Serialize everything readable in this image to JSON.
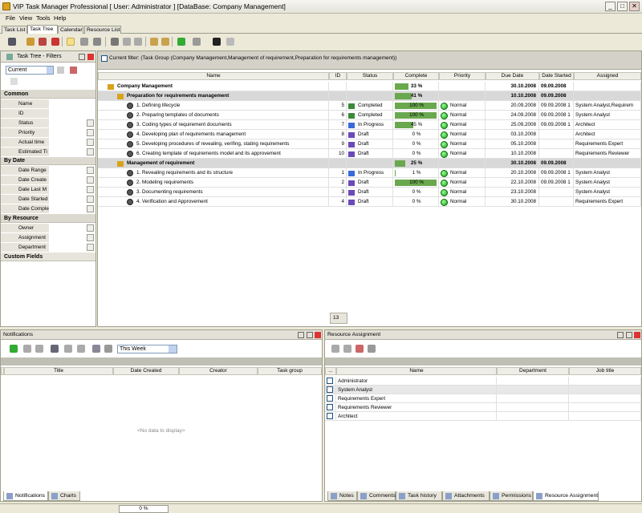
{
  "window": {
    "title": "VIP Task Manager Professional [ User: Administrator ] [DataBase: Company Management]",
    "min": "_",
    "max": "□",
    "close": "✕"
  },
  "menu": [
    "File",
    "View",
    "Tools",
    "Help"
  ],
  "tabs": [
    "Task List",
    "Task Tree",
    "Calendar",
    "Resource List"
  ],
  "left": {
    "title": "Task Tree - Filters",
    "combo": "Current",
    "sections": {
      "common": "Common",
      "bydate": "By Date",
      "byres": "By Resource",
      "custom": "Custom Fields"
    },
    "common": [
      "Name",
      "ID",
      "Status",
      "Priority",
      "Actual time",
      "Estimated Ti"
    ],
    "bydate": [
      "Date Range",
      "Date Create",
      "Date Last M",
      "Date Started",
      "Date Comple"
    ],
    "byres": [
      "Owner",
      "Assignment",
      "Department"
    ]
  },
  "main": {
    "filter": "Current filter:  (Task Group  (Company Management,Management of requirement,Preparation for requirements management))",
    "headers": [
      "Name",
      "ID",
      "Status",
      "Complete",
      "Priority",
      "Due Date",
      "Date Started",
      "Assigned"
    ],
    "footer_count": "13",
    "rows": [
      {
        "kind": "root",
        "name": "Company Management",
        "complete": "33 %",
        "pct": 0.33,
        "due": "30.10.2008",
        "started": "09.09.2008"
      },
      {
        "kind": "grp",
        "name": "Preparation for requirements management",
        "complete": "41 %",
        "pct": 0.41,
        "due": "10.10.2008",
        "started": "09.09.2008"
      },
      {
        "kind": "task",
        "name": "1. Defining lifecycle",
        "id": "5",
        "status": "Completed",
        "complete": "100 %",
        "pct": 1,
        "priority": "Normal",
        "due": "20.09.2008",
        "started": "09.09.2008 1",
        "assigned": "System Analyst,Requirem"
      },
      {
        "kind": "task",
        "name": "2. Preparing templates of documents",
        "id": "6",
        "status": "Completed",
        "complete": "100 %",
        "pct": 1,
        "priority": "Normal",
        "due": "24.09.2008",
        "started": "09.09.2008 1",
        "assigned": "System Analyst"
      },
      {
        "kind": "task",
        "name": "3. Coding types of requirement documents",
        "id": "7",
        "status": "In Progress",
        "complete": "45 %",
        "pct": 0.45,
        "priority": "Normal",
        "due": "25.09.2008",
        "started": "09.09.2008 1",
        "assigned": "Architect"
      },
      {
        "kind": "task",
        "name": "4. Developing plan of requirements management",
        "id": "8",
        "status": "Draft",
        "complete": "0 %",
        "pct": 0,
        "priority": "Normal",
        "due": "03.10.2008",
        "started": "",
        "assigned": "Architect"
      },
      {
        "kind": "task",
        "name": "5. Developing procedures of revealing, verifing, stating requirements",
        "id": "9",
        "status": "Draft",
        "complete": "0 %",
        "pct": 0,
        "priority": "Normal",
        "due": "05.10.2008",
        "started": "",
        "assigned": "Requirements Expert"
      },
      {
        "kind": "task",
        "name": "6. Creating template of requirements model and its approvement",
        "id": "10",
        "status": "Draft",
        "complete": "0 %",
        "pct": 0,
        "priority": "Normal",
        "due": "10.10.2008",
        "started": "",
        "assigned": "Requirements Reviewer"
      },
      {
        "kind": "grp",
        "name": "Management of requirement",
        "complete": "25 %",
        "pct": 0.25,
        "due": "30.10.2008",
        "started": "09.09.2008"
      },
      {
        "kind": "task",
        "name": "1. Revealing requirements and its structure",
        "id": "1",
        "status": "In Progress",
        "complete": "1 %",
        "pct": 0.01,
        "priority": "Normal",
        "due": "20.10.2008",
        "started": "09.09.2008 1",
        "assigned": "System Analyst"
      },
      {
        "kind": "task",
        "name": "2. Modeling requirements",
        "id": "2",
        "status": "Draft",
        "complete": "100 %",
        "pct": 1,
        "priority": "Normal",
        "due": "22.10.2008",
        "started": "09.09.2008 1",
        "assigned": "System Analyst"
      },
      {
        "kind": "task",
        "name": "3. Documenting requirements",
        "id": "3",
        "status": "Draft",
        "complete": "0 %",
        "pct": 0,
        "priority": "Normal",
        "due": "23.10.2008",
        "started": "",
        "assigned": "System Analyst"
      },
      {
        "kind": "task",
        "name": "4. Verification and Approvement",
        "id": "4",
        "status": "Draft",
        "complete": "0 %",
        "pct": 0,
        "priority": "Normal",
        "due": "30.10.2008",
        "started": "",
        "assigned": "Requirements Expert"
      }
    ]
  },
  "notifications": {
    "title": "Notifications",
    "period": "This Week",
    "headers": [
      "Title",
      "Date Created",
      "Creator",
      "Task group"
    ],
    "empty": "<No data to display>",
    "tabs": [
      "Notifications",
      "Charts"
    ]
  },
  "resources": {
    "title": "Resource Assignment",
    "headers": [
      "...",
      "Name",
      "Department",
      "Job title"
    ],
    "items": [
      "Administrator",
      "System Analyst",
      "Requirements Expert",
      "Requirements Reviewer",
      "Architect"
    ],
    "tabs": [
      "Notes",
      "Comments",
      "Task history",
      "Attachments",
      "Permissions",
      "Resource Assignment"
    ]
  },
  "status": {
    "progress": "0 %"
  }
}
